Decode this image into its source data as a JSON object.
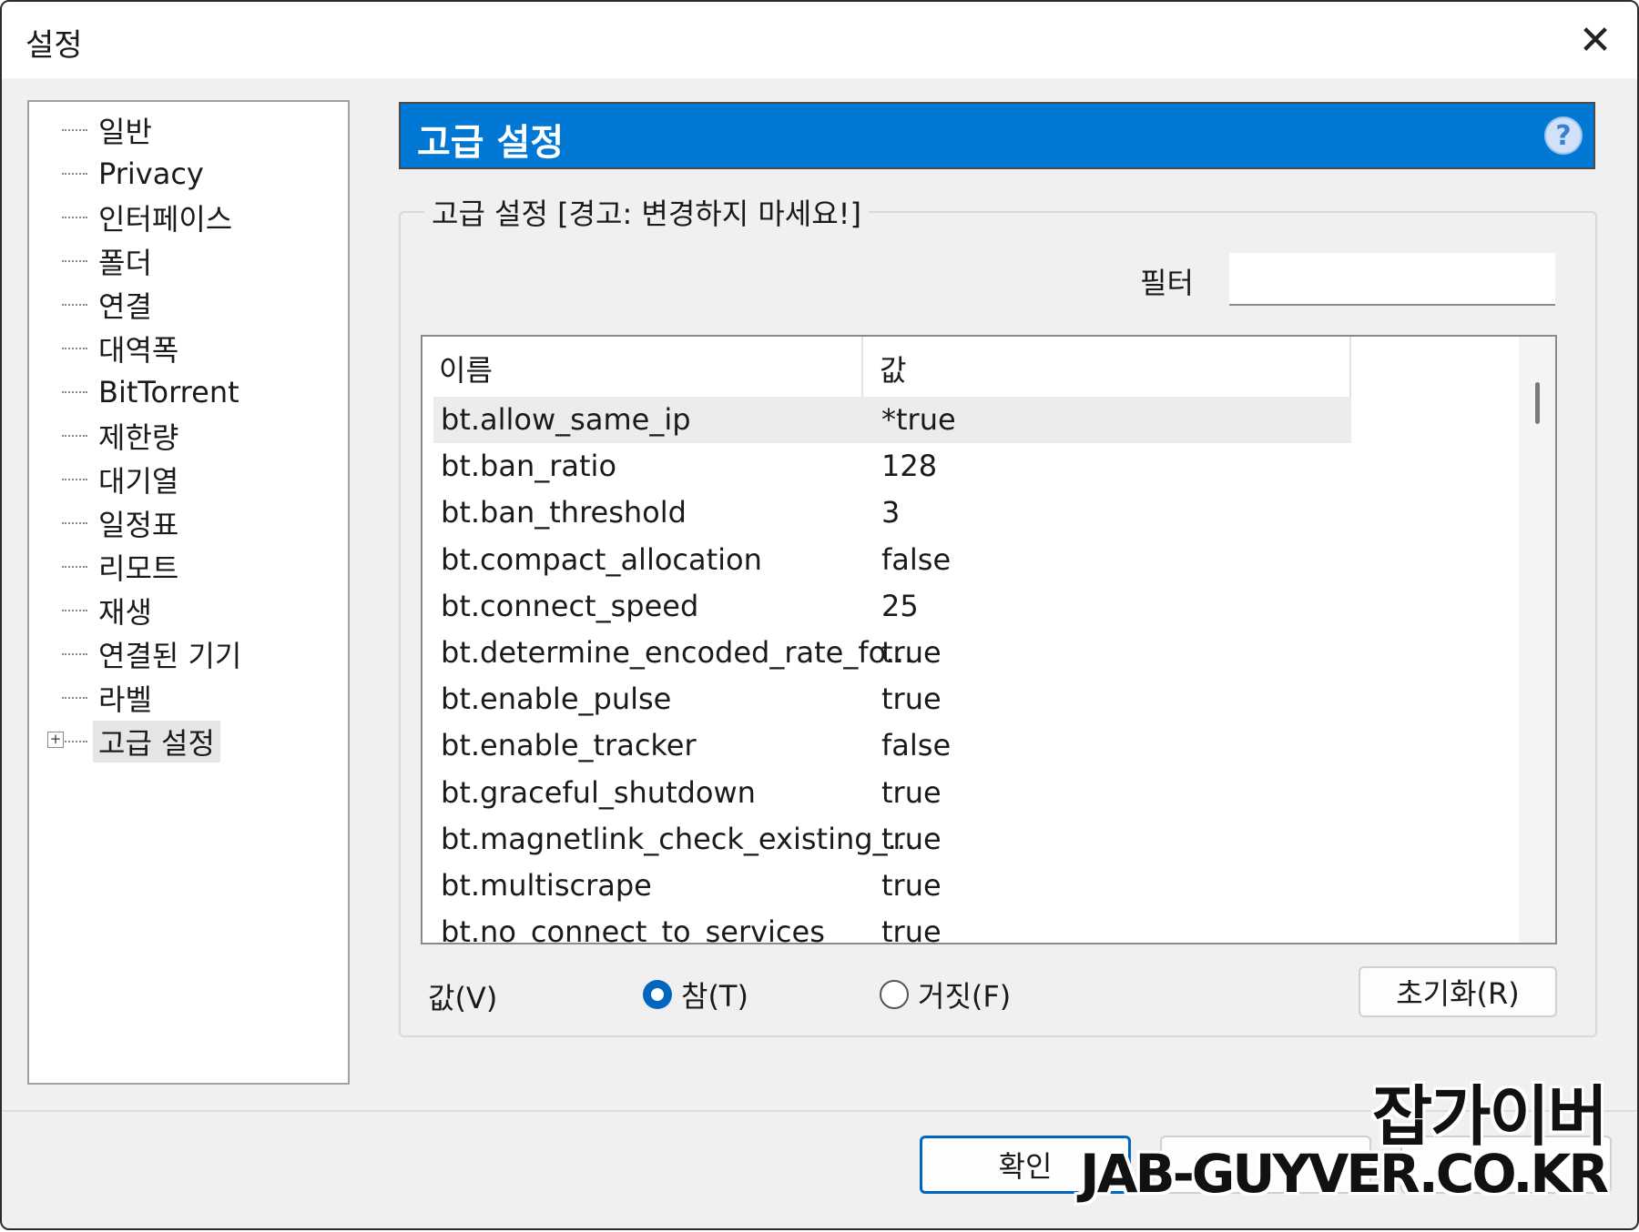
{
  "window": {
    "title": "설정"
  },
  "tree": {
    "items": [
      {
        "label": "일반"
      },
      {
        "label": "Privacy"
      },
      {
        "label": "인터페이스"
      },
      {
        "label": "폴더"
      },
      {
        "label": "연결"
      },
      {
        "label": "대역폭"
      },
      {
        "label": "BitTorrent"
      },
      {
        "label": "제한량"
      },
      {
        "label": "대기열"
      },
      {
        "label": "일정표"
      },
      {
        "label": "리모트"
      },
      {
        "label": "재생"
      },
      {
        "label": "연결된 기기"
      },
      {
        "label": "라벨"
      },
      {
        "label": "고급 설정",
        "selected": true,
        "expandable": true
      }
    ]
  },
  "header": {
    "title": "고급 설정",
    "help_icon": "question-circle-icon",
    "color": "#0078d4"
  },
  "group": {
    "legend": "고급 설정 [경고: 변경하지 마세요!]",
    "filter_label": "필터",
    "filter_value": ""
  },
  "list": {
    "columns": [
      "이름",
      "값"
    ],
    "rows": [
      {
        "name": "bt.allow_same_ip",
        "value": "*true"
      },
      {
        "name": "bt.ban_ratio",
        "value": "128"
      },
      {
        "name": "bt.ban_threshold",
        "value": "3"
      },
      {
        "name": "bt.compact_allocation",
        "value": "false"
      },
      {
        "name": "bt.connect_speed",
        "value": "25"
      },
      {
        "name": "bt.determine_encoded_rate_fo...",
        "value": "true"
      },
      {
        "name": "bt.enable_pulse",
        "value": "true"
      },
      {
        "name": "bt.enable_tracker",
        "value": "false"
      },
      {
        "name": "bt.graceful_shutdown",
        "value": "true"
      },
      {
        "name": "bt.magnetlink_check_existing_...",
        "value": "true"
      },
      {
        "name": "bt.multiscrape",
        "value": "true"
      },
      {
        "name": "bt.no_connect_to_services",
        "value": "true"
      }
    ]
  },
  "value_editor": {
    "label": "값(V)",
    "true_label": "참(T)",
    "false_label": "거짓(F)",
    "selected": "true",
    "reset_label": "초기화(R)"
  },
  "footer": {
    "ok_label": "확인"
  },
  "watermark": {
    "line1": "잡가이버",
    "line2": "JAB-GUYVER.CO.KR"
  }
}
